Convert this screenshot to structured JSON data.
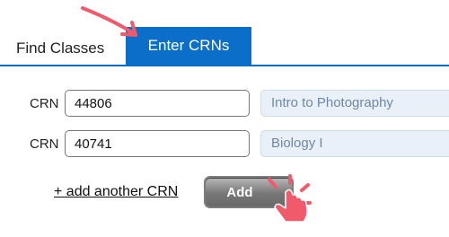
{
  "tabs": {
    "find_classes": "Find Classes",
    "enter_crns": "Enter CRNs"
  },
  "rows": [
    {
      "label": "CRN",
      "value": "44806",
      "course": "Intro to Photography"
    },
    {
      "label": "CRN",
      "value": "40741",
      "course": "Biology I"
    }
  ],
  "actions": {
    "add_another": "+ add another CRN",
    "add_button": "Add"
  },
  "annotations": {
    "arrow_icon": "curved-arrow-icon",
    "cursor_icon": "pointer-hand-icon",
    "accent_color": "#f05a6b"
  },
  "colors": {
    "tab_active": "#0b6fc9",
    "course_bg": "#e9f0f7",
    "course_text": "#6d88a8"
  }
}
